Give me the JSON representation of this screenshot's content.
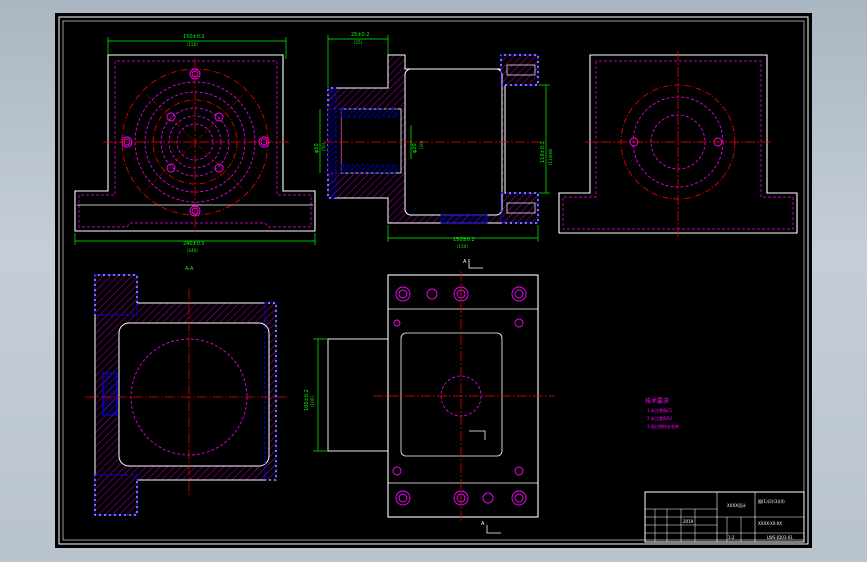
{
  "drawing": {
    "title_block_text": {
      "company": "XXXX设计",
      "part": "XXXX-XX-XX",
      "top_right": "图(1)(2)(3)(4)",
      "bottom_right": "LWS-JD03-01",
      "scale": "1:2",
      "date": "2019"
    },
    "section_markers": {
      "left_section": "A-A",
      "view_arrow_top": "A",
      "view_arrow_bottom": "A"
    },
    "tech_notes": {
      "heading": "技术要求",
      "lines": [
        "1.未注倒角C1",
        "2.未注圆角R2",
        "3.锐边倒钝去毛刺"
      ]
    },
    "dimensions": {
      "front_top": "150±0.2",
      "front_top_sub": "(150)",
      "front_bottom": "240±0.5",
      "front_bottom_sub": "(240)",
      "side_top": "25±0.2",
      "side_top_sub": "(25)",
      "side_bottom": "150±0.2",
      "side_bottom_sub": "(150)",
      "side_right": "110±0.1",
      "side_right_sub": "(110H8)",
      "side_left": "φ50",
      "side_left_sub": "(50)",
      "side_mid": "φ20",
      "side_mid_sub": "(20)",
      "front_left": "φ48",
      "front_left_sub": "(48)",
      "plan_left": "100±0.2",
      "plan_left_sub": "(100)"
    },
    "colors": {
      "background": "#000000",
      "outline": "#ffffff",
      "centerline": "#ff0000",
      "hidden": "#ff00ff",
      "dimension": "#00ff00",
      "section": "#0000ff",
      "hatch": "#ff00ff"
    }
  }
}
